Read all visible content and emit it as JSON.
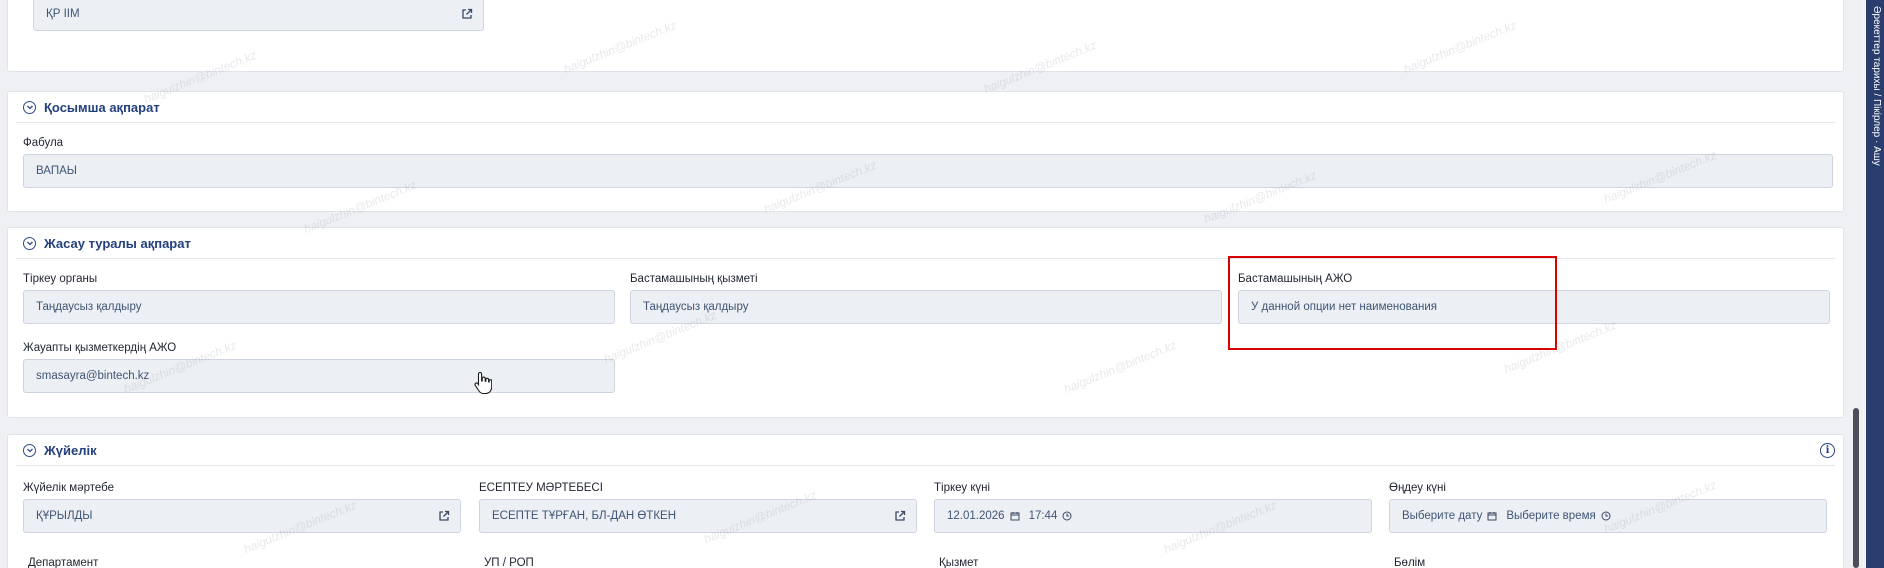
{
  "top_card": {
    "value": "ҚР ІІМ"
  },
  "qosymsha": {
    "title": "Қосымша ақпарат",
    "fabula_label": "Фабула",
    "fabula_value": "ВАПАЫ"
  },
  "jasau": {
    "title": "Жасау туралы ақпарат",
    "tirkeu_organy_label": "Тіркеу органы",
    "tirkeu_organy_value": "Таңдаусыз қалдыру",
    "bastamashy_qyzmeti_label": "Бастамашының қызметі",
    "bastamashy_qyzmeti_value": "Таңдаусыз қалдыру",
    "bastamashy_azho_label": "Бастамашының АЖО",
    "bastamashy_azho_value": "У данной опции нет наименования",
    "jauapty_label": "Жауапты қызметкердің АЖО",
    "jauapty_value": "smasayra@bintech.kz"
  },
  "juyelik": {
    "title": "Жүйелік",
    "info_glyph": "i",
    "status_label": "Жүйелік мәртебе",
    "status_value": "ҚҰРЫЛДЫ",
    "esep_label": "ЕСЕПТЕУ МӘРТЕБЕСІ",
    "esep_value": "ЕСЕПТЕ ТҰРҒАН, БЛ-ДАН ӨТКЕН",
    "tirkeu_kuni_label": "Тіркеу күні",
    "tirkeu_date": "12.01.2026",
    "tirkeu_time": "17:44",
    "ondeu_kuni_label": "Өңдеу күні",
    "ondeu_date_placeholder": "Выберите дату",
    "ondeu_time_placeholder": "Выберите время",
    "departament_label": "Департамент",
    "up_rop_label": "УП / РОП",
    "qyzmet_label": "Қызмет",
    "bolim_label": "Бөлім"
  },
  "side_panel": {
    "text": "Әрекеттер тарихы / Пікірлер · Ашу"
  },
  "watermark": {
    "text": "haigulzhin@bintech.kz"
  },
  "colors": {
    "accent": "#24407e",
    "highlight": "#d90000",
    "field_bg": "#eceff3"
  }
}
